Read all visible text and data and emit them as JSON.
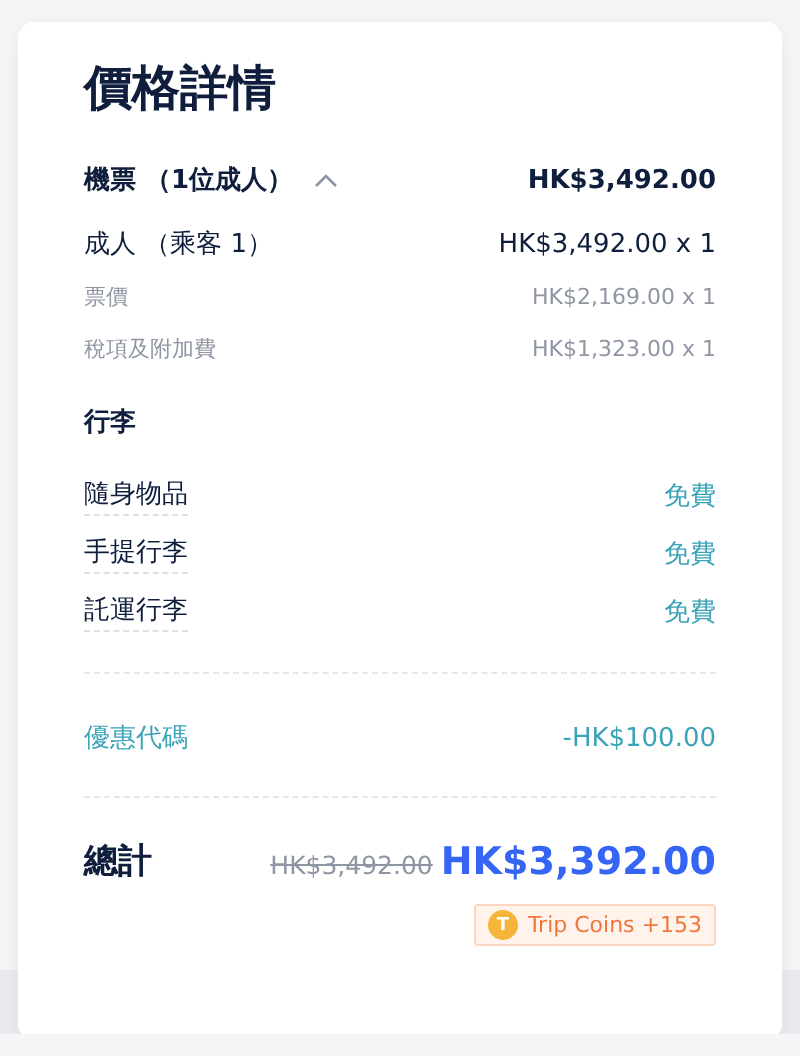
{
  "title": "價格詳情",
  "ticket": {
    "label": "機票 （1位成人）",
    "expanded": true,
    "amount": "HK$3,492.00"
  },
  "passenger": {
    "label": "成人 （乘客 1）",
    "amount": "HK$3,492.00 x 1"
  },
  "fare_lines": [
    {
      "label": "票價",
      "amount": "HK$2,169.00 x 1"
    },
    {
      "label": "稅項及附加費",
      "amount": "HK$1,323.00 x 1"
    }
  ],
  "baggage": {
    "heading": "行李",
    "items": [
      {
        "label": "隨身物品",
        "price": "免費"
      },
      {
        "label": "手提行李",
        "price": "免費"
      },
      {
        "label": "託運行李",
        "price": "免費"
      }
    ]
  },
  "promo": {
    "label": "優惠代碼",
    "amount": "-HK$100.00"
  },
  "total": {
    "label": "總計",
    "original": "HK$3,492.00",
    "amount": "HK$3,392.00"
  },
  "coins": {
    "symbol": "T",
    "label": "Trip Coins +153"
  }
}
